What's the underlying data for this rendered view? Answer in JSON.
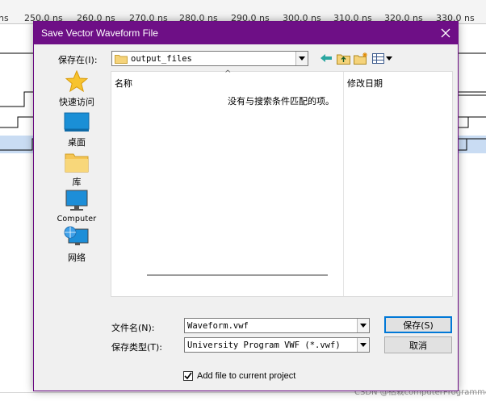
{
  "background": {
    "time_ticks": [
      "250.0 ns",
      "260.0 ns",
      "270.0 ns",
      "280.0 ns",
      "290.0 ns",
      "300.0 ns",
      "310.0 ns",
      "320.0 ns",
      "330.0 ns"
    ],
    "partial_left_tick": "ns",
    "watermark": "CSDN @祜栽computerProgrammer"
  },
  "dialog": {
    "title": "Save Vector Waveform File",
    "save_in_label": "保存在(I):",
    "save_in_value": "output_files",
    "places": [
      {
        "label": "快速访问",
        "icon": "star-icon"
      },
      {
        "label": "桌面",
        "icon": "desktop-icon"
      },
      {
        "label": "库",
        "icon": "library-folder-icon"
      },
      {
        "label": "Computer",
        "icon": "computer-icon"
      },
      {
        "label": "网络",
        "icon": "network-icon"
      }
    ],
    "columns": {
      "name": "名称",
      "modified": "修改日期"
    },
    "empty_message": "没有与搜索条件匹配的项。",
    "filename_label": "文件名(N):",
    "filename_value": "Waveform.vwf",
    "filetype_label": "保存类型(T):",
    "filetype_value": "University Program VWF (*.vwf)",
    "save_button": "保存(S)",
    "cancel_button": "取消",
    "add_file_label": "Add file to current project",
    "add_file_checked": true
  },
  "colors": {
    "titlebar": "#6e0f86",
    "selection": "#c9dcf3"
  }
}
